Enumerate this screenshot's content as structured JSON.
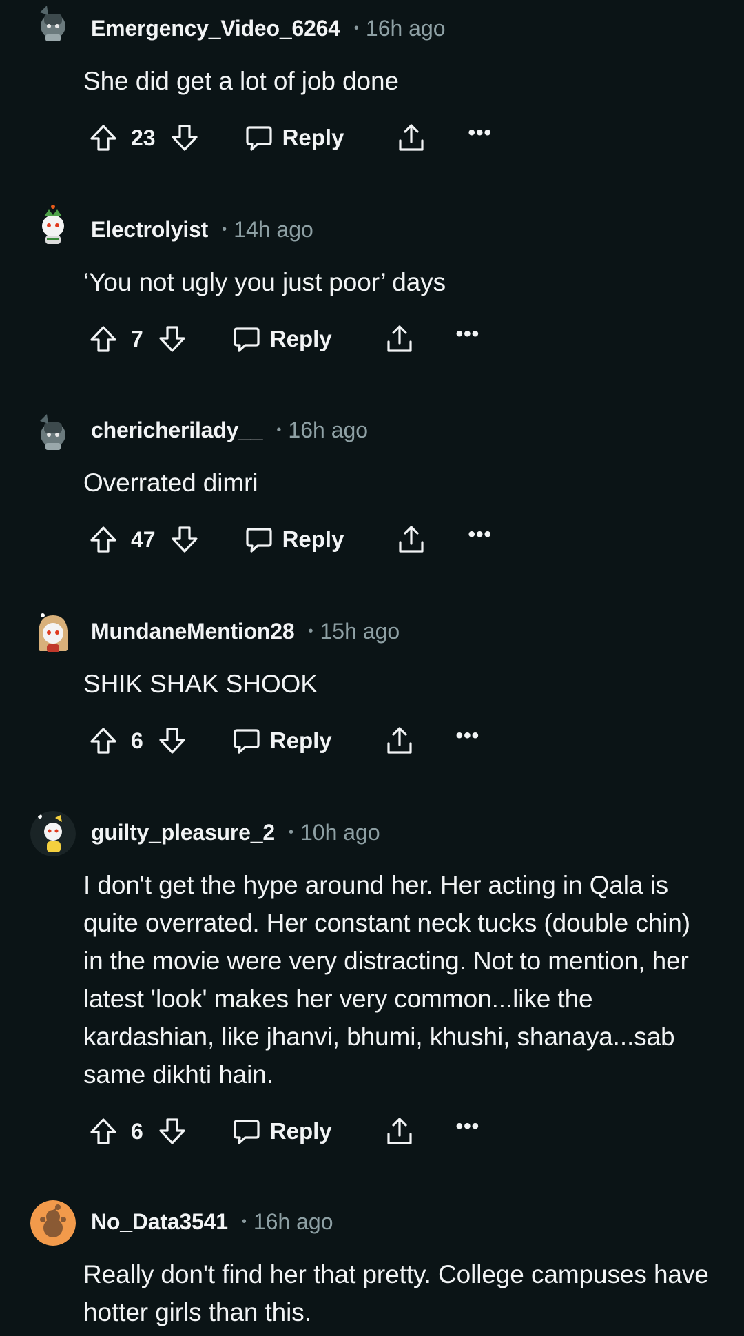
{
  "comments": [
    {
      "username": "Emergency_Video_6264",
      "separator": "•",
      "time": "16h ago",
      "body": "She did get a lot of job done",
      "votes": "23",
      "reply_label": "Reply",
      "more_label": "•••"
    },
    {
      "username": "Electrolyist",
      "separator": "•",
      "time": "14h ago",
      "body": "‘You not ugly you just poor’ days",
      "votes": "7",
      "reply_label": "Reply",
      "more_label": "•••"
    },
    {
      "username": "chericherilady__",
      "separator": "•",
      "time": "16h ago",
      "body": "Overrated dimri",
      "votes": "47",
      "reply_label": "Reply",
      "more_label": "•••"
    },
    {
      "username": "MundaneMention28",
      "separator": "•",
      "time": "15h ago",
      "body": "SHIK SHAK SHOOK",
      "votes": "6",
      "reply_label": "Reply",
      "more_label": "•••"
    },
    {
      "username": "guilty_pleasure_2",
      "separator": "•",
      "time": "10h ago",
      "body": "I don't get the hype around her. Her acting in Qala is quite overrated. Her constant neck tucks (double chin) in the movie were very distracting. Not to mention, her latest 'look' makes her very common...like the kardashian, like jhanvi, bhumi, khushi, shanaya...sab same dikhti hain.",
      "votes": "6",
      "reply_label": "Reply",
      "more_label": "•••"
    },
    {
      "username": "No_Data3541",
      "separator": "•",
      "time": "16h ago",
      "body": "Really don't find her that pretty. College campuses have hotter girls than this."
    }
  ],
  "icons": {
    "upvote": "upvote-arrow-icon",
    "downvote": "downvote-arrow-icon",
    "reply": "speech-bubble-icon",
    "share": "share-upload-icon",
    "more": "ellipsis-icon",
    "avatar": "reddit-snoo-avatar-icon"
  },
  "colors": {
    "background": "#0b1416",
    "text": "#f2f4f5",
    "muted": "#8ea0a4",
    "avatar_orange": "#f29a4b"
  }
}
